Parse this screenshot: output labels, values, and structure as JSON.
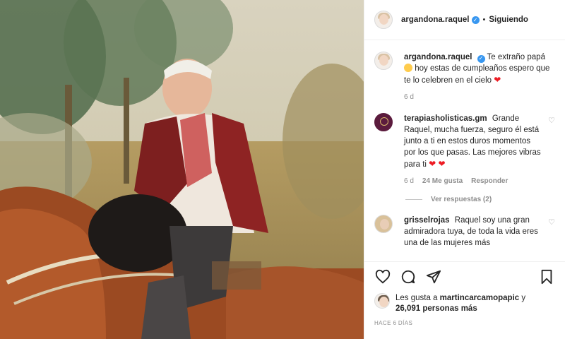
{
  "header": {
    "username": "argandona.raquel",
    "separator": "•",
    "following_label": "Siguiendo"
  },
  "caption": {
    "username": "argandona.raquel",
    "text_part1": "Te extraño papá",
    "text_part2": "hoy estas de cumpleaños espero que te lo celebren en el cielo",
    "age": "6 d"
  },
  "comments": [
    {
      "username": "terapiasholisticas.gm",
      "text": "Grande Raquel, mucha fuerza, seguro él está junto a ti en estos duros momentos por los que pasas. Las mejores vibras para ti",
      "age": "6 d",
      "likes": "24 Me gusta",
      "reply_label": "Responder",
      "view_replies": "Ver respuestas (2)"
    },
    {
      "username": "grisselrojas",
      "text": "Raquel soy una gran admiradora tuya, de toda la vida eres una de las mujeres más"
    }
  ],
  "likes": {
    "prefix": "Les gusta a",
    "user": "martincarcamopapic",
    "connector": "y",
    "count": "26,091 personas más"
  },
  "timestamp": "HACE 6 DÍAS",
  "icons": {
    "like": "heart-icon",
    "comment": "comment-icon",
    "share": "share-icon",
    "save": "bookmark-icon",
    "verified": "verified-icon"
  },
  "colors": {
    "verified_blue": "#3897f0",
    "heart_red": "#ed1c24",
    "meta_gray": "#8e8e8e"
  }
}
